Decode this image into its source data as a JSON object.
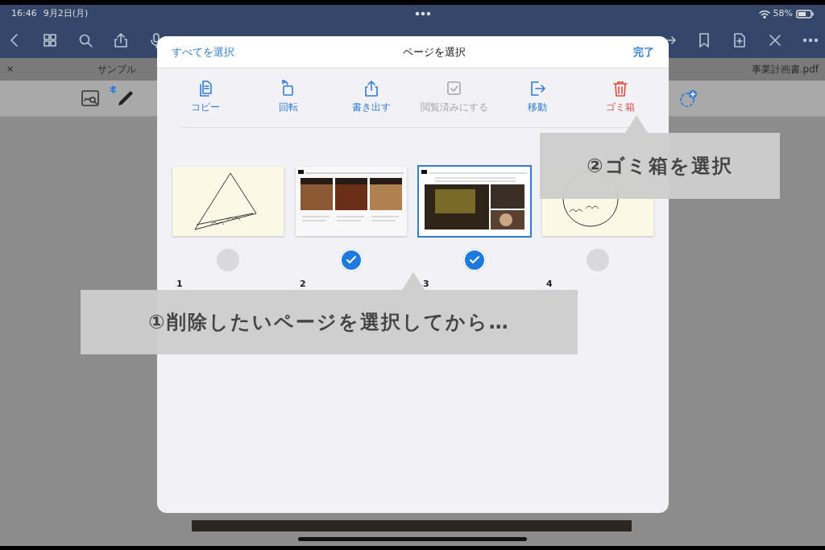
{
  "status_bar": {
    "time": "16:46",
    "date": "9月2日(月)",
    "battery": "58%"
  },
  "tabs": [
    {
      "close": "×",
      "label": "サンプル"
    },
    {
      "label": "事業計画書.pdf"
    }
  ],
  "sheet": {
    "select_all": "すべてを選択",
    "title": "ページを選択",
    "done": "完了",
    "actions": [
      {
        "kind": "copy",
        "label": "コピー",
        "disabled": false,
        "destructive": false
      },
      {
        "kind": "rotate",
        "label": "回転",
        "disabled": false,
        "destructive": false
      },
      {
        "kind": "export",
        "label": "書き出す",
        "disabled": false,
        "destructive": false
      },
      {
        "kind": "mark-read",
        "label": "閲覧済みにする",
        "disabled": true,
        "destructive": false
      },
      {
        "kind": "move",
        "label": "移動",
        "disabled": false,
        "destructive": false
      },
      {
        "kind": "trash",
        "label": "ゴミ箱",
        "disabled": false,
        "destructive": true
      }
    ],
    "pages": [
      {
        "number": "1",
        "kind": "sketch-triangle",
        "selected": false,
        "current": false
      },
      {
        "number": "2",
        "kind": "three-column",
        "selected": true,
        "current": false
      },
      {
        "number": "3",
        "kind": "photo-page",
        "selected": true,
        "current": true
      },
      {
        "number": "4",
        "kind": "sketch-circle",
        "selected": false,
        "current": false
      }
    ]
  },
  "callouts": [
    {
      "text": "②ゴミ箱を選択"
    },
    {
      "text": "①削除したいページを選択してから…"
    }
  ]
}
